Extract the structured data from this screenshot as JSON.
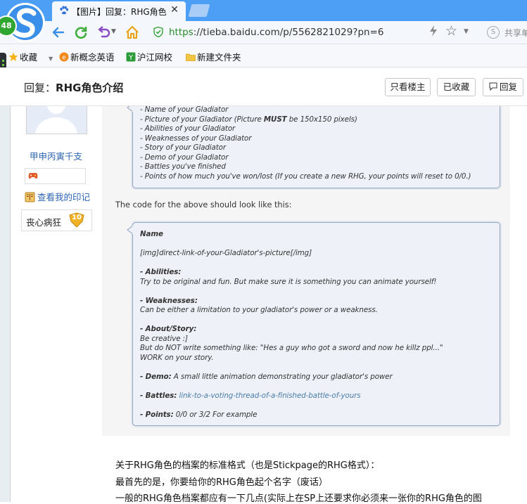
{
  "browser": {
    "badge_count": "48",
    "tab_title": "【图片】回复：RHG角色",
    "url_scheme": "https",
    "url_rest": "://tieba.baidu.com/p/5562821029?pn=6",
    "share_label": "共享单",
    "bookmarks": [
      {
        "label": "收藏",
        "icon": "star-icon"
      },
      {
        "label": "新概念英语",
        "icon": "app-icon"
      },
      {
        "label": "沪江网校",
        "icon": "app-icon"
      },
      {
        "label": "新建文件夹",
        "icon": "folder-icon"
      }
    ]
  },
  "thread": {
    "title_prefix": "回复：",
    "title_main": "RHG角色介绍",
    "buttons": {
      "only_op": "只看楼主",
      "favorited": "已收藏",
      "reply": "回复"
    }
  },
  "user": {
    "name": "甲申丙寅千支",
    "impression_link": "查看我的印记",
    "level_name": "丧心病狂",
    "level": "10"
  },
  "quote1": {
    "lines": [
      "- Name of your Gladiator",
      "- Picture of your Gladiator (Picture ",
      "- Abilities of your Gladiator",
      "- Weaknesses of your Gladiator",
      "- Story of your Gladiator",
      "- Demo of your Gladiator",
      "- Battles you've finished",
      "- Points of how much you've won/lost (If you create a new RHG, your points will reset to 0/0.)"
    ],
    "must": "MUST",
    "must_tail": " be 150x150 pixels)"
  },
  "code_intro": "The code for the above should look like this:",
  "quote2": {
    "name": "Name",
    "img": "[img]direct-link-of-your-Gladiator's-picture[/img]",
    "abilities_label": "- Abilities:",
    "abilities_text": "Try to be original and fun. But make sure it is something you can animate yourself!",
    "weaknesses_label": "- Weaknesses:",
    "weaknesses_text": "Can be either a limitation to your gladiator's power or a weakness.",
    "story_label": "- About/Story:",
    "story_text1": "Be creative :]",
    "story_text2": "But do NOT write something like: \"Hes a guy who got a sword and now he killz ppl...\"",
    "story_text3": "WORK on your story.",
    "demo_label": "- Demo:",
    "demo_text": " A small little animation demonstrating your gladiator's power",
    "battles_label": "- Battles:",
    "battles_link": " link-to-a-voting-thread-of-a-finished-battle-of-yours",
    "points_label": "- Points:",
    "points_text": " 0/0 or 3/2 For example"
  },
  "post": {
    "lines": [
      "关于RHG角色的档案的标准格式（也是Stickpage的RHG格式）：",
      "最首先的是，你要给你的RHG角色起个名字（废话）",
      "一般的RHG角色档案都应有一下几点(实际上在SP上还要求你必须来一张你的RHG角色的图"
    ]
  },
  "colors": {
    "titlebar": "#4d9ff5",
    "link": "#2d64b3",
    "quote_bg": "#eef2f8",
    "quote_border": "#8fa3bd"
  }
}
